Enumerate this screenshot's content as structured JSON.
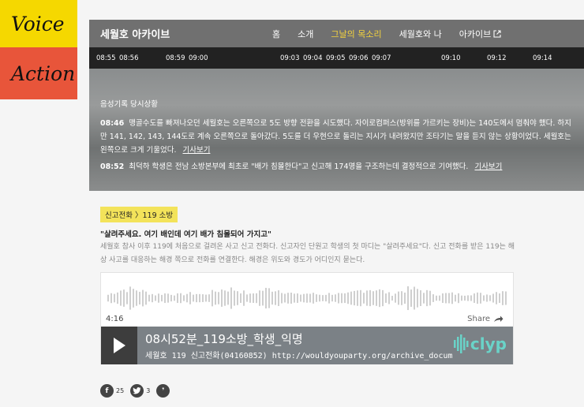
{
  "side": {
    "voice": "Voice",
    "action": "Action"
  },
  "header": {
    "brand": "세월호 아카이브",
    "nav": [
      "홈",
      "소개",
      "그날의 목소리",
      "세월호와 나",
      "아카이브"
    ],
    "active_color": "#f3d23e"
  },
  "timeline": [
    "08:55",
    "08:56",
    "08:59",
    "09:00",
    "09:03",
    "09:04",
    "09:05",
    "09:06",
    "09:07",
    "09:10",
    "09:12",
    "09:14"
  ],
  "hero": {
    "label": "음성기록 당시상황",
    "items": [
      {
        "time": "08:46",
        "text": "맹골수도를 빠져나오던 세월호는 오른쪽으로 5도 방향 전환을 시도했다. 자이로컴퍼스(방위를 가르키는 장비)는 140도에서 멈춰야 했다. 하지만 141, 142, 143, 144도로 계속 오른쪽으로 돌아갔다. 5도를 더 우현으로 돌리는 지시가 내려왔지만 조타기는 말을 듣지 않는 상황이었다. 세월호는 왼쪽으로 크게 기울었다.",
        "link": "기사보기"
      },
      {
        "time": "08:52",
        "text": "최덕하 학생은 전남 소방본부에 최초로 \"배가 침몰한다\"고 신고해 174명을 구조하는데 결정적으로 기여했다.",
        "link": "기사보기"
      }
    ]
  },
  "content": {
    "tag": "신고전화 〉119 소방",
    "quote": "\"살려주세요. 여기 배인데 여기 배가 침몰되어 가지고\"",
    "description": "세월호 참사 이후 119에 처음으로 걸려온 사고 신고 전화다. 신고자인 단원고 학생의 첫 마디는 \"살려주세요\"다. 신고 전화를 받은 119는 해상 사고를 대응하는 해경 쪽으로 전화를 연결한다. 해경은 위도와 경도가 어디인지 묻는다."
  },
  "player": {
    "duration": "4:16",
    "share_label": "Share",
    "title": "08시52분_119소방_학생_익명",
    "subtitle": "세월호 119 신고전화(04160852) http://wouldyouparty.org/archive_docum...",
    "brand": "clyp",
    "brand_color": "#6ad3c8"
  },
  "social": [
    {
      "icon": "facebook-icon",
      "glyph": "f",
      "count": "25"
    },
    {
      "icon": "twitter-icon",
      "glyph": "t",
      "count": "3"
    },
    {
      "icon": "kakaostory-icon",
      "glyph": "❜",
      "count": ""
    }
  ]
}
